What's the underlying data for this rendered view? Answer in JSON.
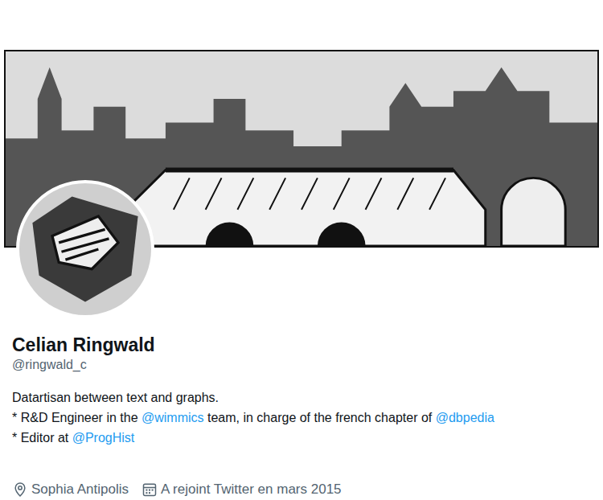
{
  "profile": {
    "name": "Celian Ringwald",
    "handle": "@ringwald_c",
    "bio": [
      {
        "segments": [
          {
            "kind": "text",
            "text": "Datartisan between text and graphs."
          }
        ]
      },
      {
        "segments": [
          {
            "kind": "text",
            "text": "* R&D Engineer in the "
          },
          {
            "kind": "mention",
            "text": "@wimmics"
          },
          {
            "kind": "text",
            "text": " team, in charge of the french chapter of "
          },
          {
            "kind": "mention",
            "text": "@dbpedia"
          }
        ]
      },
      {
        "segments": [
          {
            "kind": "text",
            "text": "* Editor at "
          },
          {
            "kind": "mention",
            "text": "@ProgHist"
          }
        ]
      }
    ],
    "location": "Sophia Antipolis",
    "joined": "A rejoint Twitter en mars 2015"
  }
}
